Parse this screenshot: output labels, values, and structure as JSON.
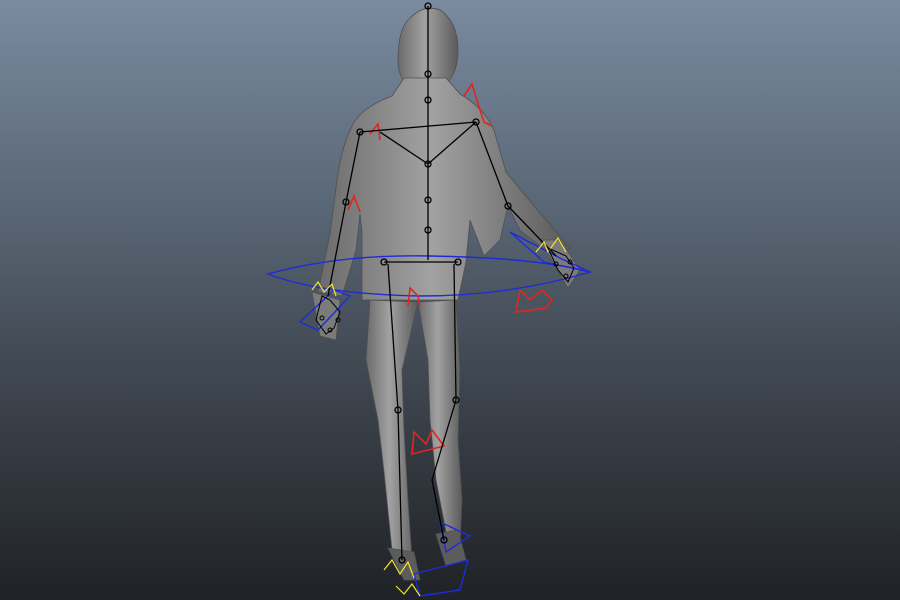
{
  "viewport": {
    "background_top": "#7a8ba0",
    "background_bottom": "#1f2226"
  },
  "scene": {
    "character": "human-male-model",
    "mesh_color": "#8d8d8d",
    "bone_color": "#000000",
    "ik_handle_color": "#e0261e",
    "nurbs_control_color": "#1f2bd6",
    "selected_control_color": "#f2e52c"
  },
  "hud": {
    "camera_label": ""
  }
}
